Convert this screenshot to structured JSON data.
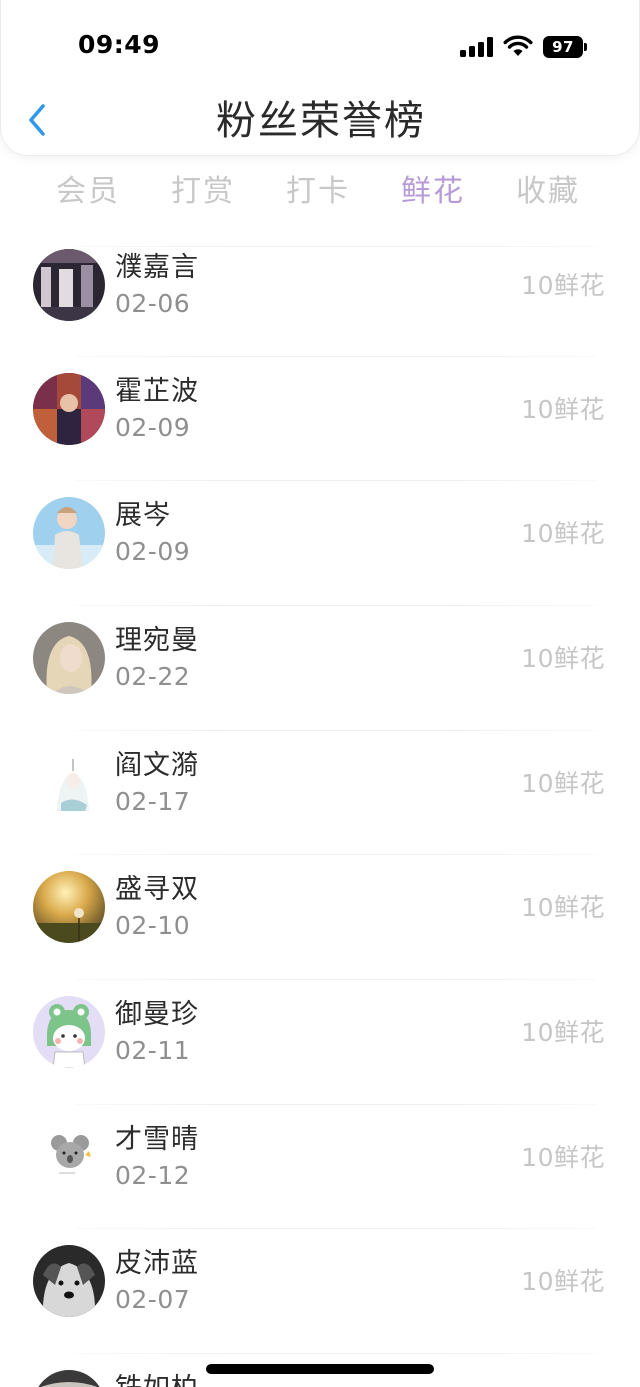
{
  "status_bar": {
    "time": "09:49",
    "battery": "97"
  },
  "header": {
    "title": "粉丝荣誉榜"
  },
  "tabs": [
    {
      "label": "会员",
      "active": false
    },
    {
      "label": "打赏",
      "active": false
    },
    {
      "label": "打卡",
      "active": false
    },
    {
      "label": "鲜花",
      "active": true
    },
    {
      "label": "收藏",
      "active": false
    }
  ],
  "colors": {
    "active_tab": "#b79ad8",
    "inactive_tab": "#c8c8c8",
    "back_icon": "#2f9be8"
  },
  "fans": [
    {
      "name": "濮嘉言",
      "date": "02-06",
      "amount": "10鲜花",
      "avatar": "avatar-photo-dark-stage"
    },
    {
      "name": "霍芷波",
      "date": "02-09",
      "amount": "10鲜花",
      "avatar": "avatar-photo-colorful-collage"
    },
    {
      "name": "展岑",
      "date": "02-09",
      "amount": "10鲜花",
      "avatar": "avatar-photo-boy-blue-sky"
    },
    {
      "name": "理宛曼",
      "date": "02-22",
      "amount": "10鲜花",
      "avatar": "avatar-photo-blonde-woman"
    },
    {
      "name": "阎文漪",
      "date": "02-17",
      "amount": "10鲜花",
      "avatar": "avatar-illustration-white-figure"
    },
    {
      "name": "盛寻双",
      "date": "02-10",
      "amount": "10鲜花",
      "avatar": "avatar-photo-dandelion-sunset"
    },
    {
      "name": "御曼珍",
      "date": "02-11",
      "amount": "10鲜花",
      "avatar": "avatar-cartoon-frog-hood"
    },
    {
      "name": "才雪晴",
      "date": "02-12",
      "amount": "10鲜花",
      "avatar": "avatar-cartoon-koala"
    },
    {
      "name": "皮沛蓝",
      "date": "02-07",
      "amount": "10鲜花",
      "avatar": "avatar-photo-bw-dog"
    },
    {
      "name": "铁如柏",
      "date": "",
      "amount": "",
      "avatar": "avatar-photo-partial"
    }
  ]
}
